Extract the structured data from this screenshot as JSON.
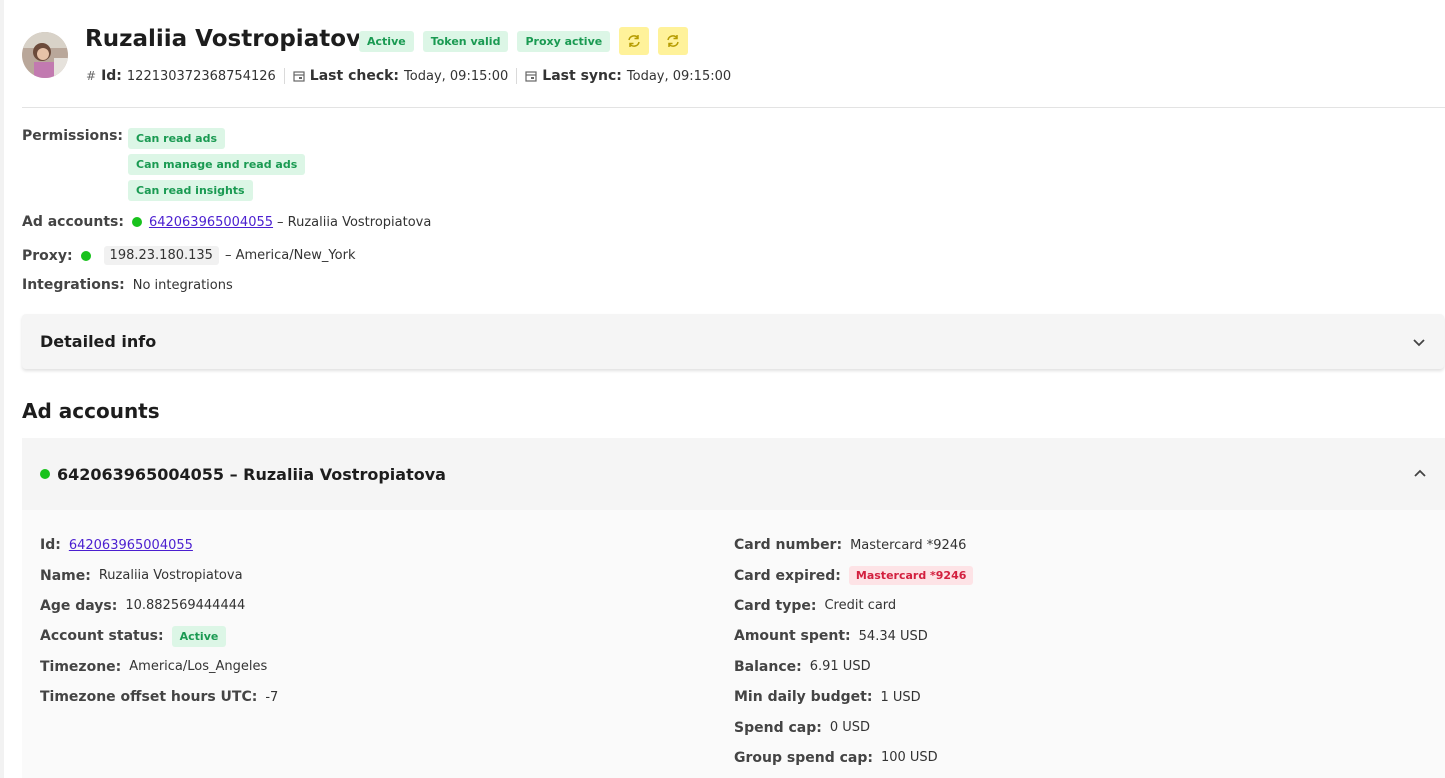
{
  "profile": {
    "name": "Ruzaliia Vostropiatova",
    "badges": [
      "Active",
      "Token valid",
      "Proxy active"
    ],
    "id_label": "Id:",
    "id_value": "122130372368754126",
    "last_check_label": "Last check:",
    "last_check_value": "Today, 09:15:00",
    "last_sync_label": "Last sync:",
    "last_sync_value": "Today, 09:15:00",
    "sync_icon": "refresh-icon"
  },
  "info": {
    "permissions_label": "Permissions:",
    "permissions": [
      "Can read ads",
      "Can manage and read ads",
      "Can read insights"
    ],
    "ad_accounts_label": "Ad accounts:",
    "ad_account_id": "642063965004055",
    "ad_account_suffix": "– Ruzaliia Vostropiatova",
    "proxy_label": "Proxy:",
    "proxy_ip": "198.23.180.135",
    "proxy_suffix": "– America/New_York",
    "integrations_label": "Integrations:",
    "integrations_value": "No integrations"
  },
  "detailed_info": {
    "title": "Detailed info"
  },
  "ad_accounts_section": {
    "title": "Ad accounts",
    "account_header": "642063965004055 – Ruzaliia Vostropiatova",
    "left": {
      "id_label": "Id:",
      "id_value": "642063965004055",
      "name_label": "Name:",
      "name_value": "Ruzaliia Vostropiatova",
      "age_label": "Age days:",
      "age_value": "10.882569444444",
      "status_label": "Account status:",
      "status_value": "Active",
      "tz_label": "Timezone:",
      "tz_value": "America/Los_Angeles",
      "tz_offset_label": "Timezone offset hours UTC:",
      "tz_offset_value": "-7"
    },
    "right": {
      "card_number_label": "Card number:",
      "card_number_value": "Mastercard *9246",
      "card_expired_label": "Card expired:",
      "card_expired_value": "Mastercard *9246",
      "card_type_label": "Card type:",
      "card_type_value": "Credit card",
      "amount_spent_label": "Amount spent:",
      "amount_spent_value": "54.34 USD",
      "balance_label": "Balance:",
      "balance_value": "6.91 USD",
      "min_daily_label": "Min daily budget:",
      "min_daily_value": "1 USD",
      "spend_cap_label": "Spend cap:",
      "spend_cap_value": "0 USD",
      "group_cap_label": "Group spend cap:",
      "group_cap_value": "100 USD"
    }
  },
  "colors": {
    "badge_green_bg": "#dcf6e6",
    "badge_green_text": "#1a9a52",
    "badge_red_bg": "#fde3e6",
    "badge_red_text": "#d3203f",
    "sync_button": "#fff29a",
    "status_dot": "#18c21c",
    "link": "#4b1fd0"
  }
}
